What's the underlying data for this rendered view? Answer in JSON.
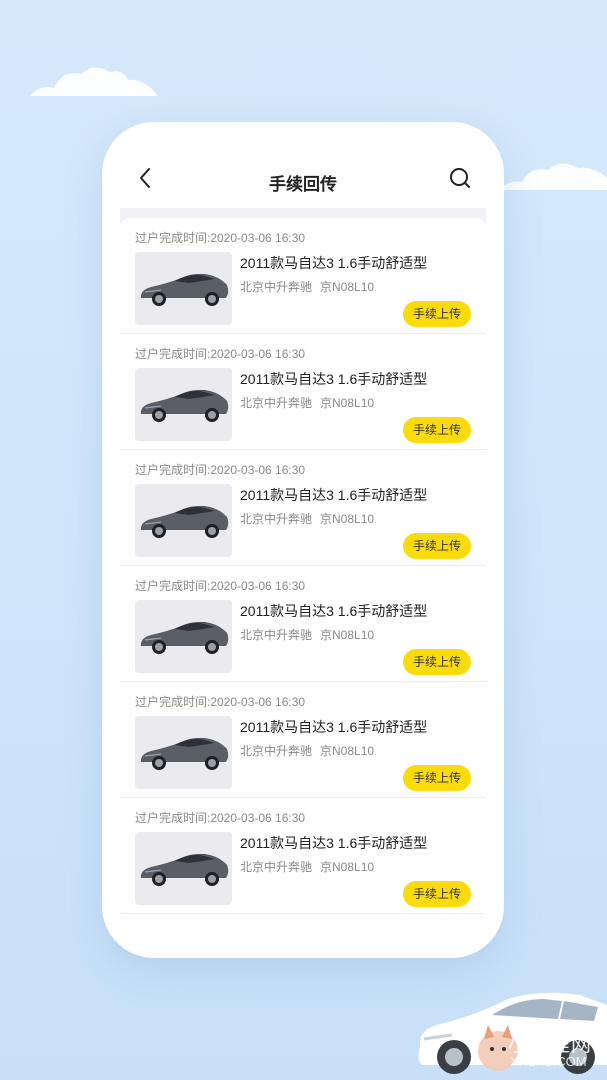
{
  "header": {
    "title": "手续回传",
    "back_icon": "chevron-left-icon",
    "search_icon": "search-icon"
  },
  "records": [
    {
      "time": "过户完成时间:2020-03-06 16:30",
      "car": "2011款马自达3 1.6手动舒适型",
      "dealer": "北京中升奔驰",
      "plate": "京N08L10",
      "action": "手续上传"
    },
    {
      "time": "过户完成时间:2020-03-06 16:30",
      "car": "2011款马自达3 1.6手动舒适型",
      "dealer": "北京中升奔驰",
      "plate": "京N08L10",
      "action": "手续上传"
    },
    {
      "time": "过户完成时间:2020-03-06 16:30",
      "car": "2011款马自达3 1.6手动舒适型",
      "dealer": "北京中升奔驰",
      "plate": "京N08L10",
      "action": "手续上传"
    },
    {
      "time": "过户完成时间:2020-03-06 16:30",
      "car": "2011款马自达3 1.6手动舒适型",
      "dealer": "北京中升奔驰",
      "plate": "京N08L10",
      "action": "手续上传"
    },
    {
      "time": "过户完成时间:2020-03-06 16:30",
      "car": "2011款马自达3 1.6手动舒适型",
      "dealer": "北京中升奔驰",
      "plate": "京N08L10",
      "action": "手续上传"
    },
    {
      "time": "过户完成时间:2020-03-06 16:30",
      "car": "2011款马自达3 1.6手动舒适型",
      "dealer": "北京中升奔驰",
      "plate": "京N08L10",
      "action": "手续上传"
    }
  ],
  "watermark": {
    "text": "小狐狸网",
    "sub": "XHLKS.COM"
  },
  "colors": {
    "accent": "#fbdc0a",
    "background": "#d6e9fb",
    "muted_text": "#8a8a8a"
  }
}
